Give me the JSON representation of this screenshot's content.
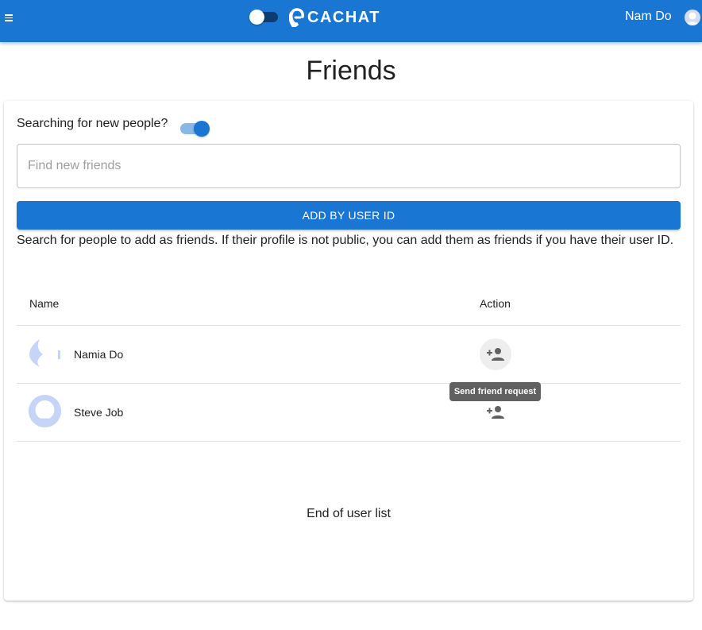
{
  "header": {
    "app_name": "CACHAT",
    "user_name": "Nam Do",
    "colors": {
      "bar": "#1976d2",
      "primary": "#1976d2"
    },
    "icons": [
      "menu-icon",
      "theme-toggle",
      "logo-icon",
      "user-avatar"
    ]
  },
  "page": {
    "title": "Friends"
  },
  "search": {
    "toggle_label": "Searching for new people?",
    "toggle_on": true,
    "placeholder": "Find new friends",
    "value": "",
    "add_button_label": "ADD BY USER ID",
    "help_text": "Search for people to add as friends. If their profile is not public, you can add them as friends if you have their user ID."
  },
  "table": {
    "headers": {
      "name": "Name",
      "action": "Action"
    },
    "rows": [
      {
        "name": "Namia Do",
        "action_icon": "person-add-icon"
      },
      {
        "name": "Steve Job",
        "action_icon": "person-add-icon"
      }
    ],
    "tooltip": "Send friend request",
    "end_text": "End of user list"
  }
}
